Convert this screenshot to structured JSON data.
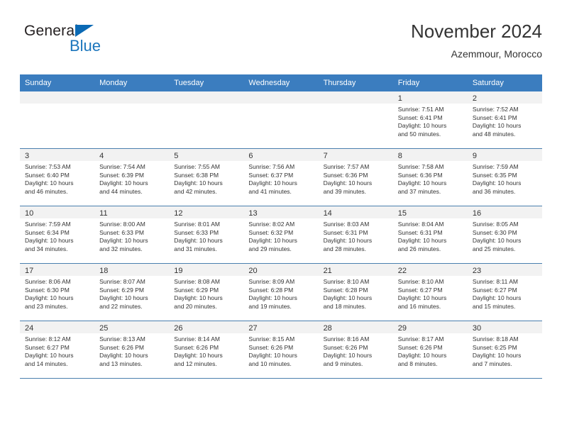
{
  "brand": {
    "name_top": "General",
    "name_bottom": "Blue",
    "triangle_color": "#0a69b4",
    "blue_text_color": "#1b75bc"
  },
  "header": {
    "title": "November 2024",
    "subtitle": "Azemmour, Morocco"
  },
  "colors": {
    "header_row_bg": "#3b7dbf",
    "header_row_text": "#ffffff",
    "daynum_strip_bg": "#f2f2f2",
    "row_divider": "#4a7fae",
    "body_text": "#333333"
  },
  "weekdays": [
    "Sunday",
    "Monday",
    "Tuesday",
    "Wednesday",
    "Thursday",
    "Friday",
    "Saturday"
  ],
  "weeks": [
    [
      {
        "day": "",
        "lines": []
      },
      {
        "day": "",
        "lines": []
      },
      {
        "day": "",
        "lines": []
      },
      {
        "day": "",
        "lines": []
      },
      {
        "day": "",
        "lines": []
      },
      {
        "day": "1",
        "lines": [
          "Sunrise: 7:51 AM",
          "Sunset: 6:41 PM",
          "Daylight: 10 hours",
          "and 50 minutes."
        ]
      },
      {
        "day": "2",
        "lines": [
          "Sunrise: 7:52 AM",
          "Sunset: 6:41 PM",
          "Daylight: 10 hours",
          "and 48 minutes."
        ]
      }
    ],
    [
      {
        "day": "3",
        "lines": [
          "Sunrise: 7:53 AM",
          "Sunset: 6:40 PM",
          "Daylight: 10 hours",
          "and 46 minutes."
        ]
      },
      {
        "day": "4",
        "lines": [
          "Sunrise: 7:54 AM",
          "Sunset: 6:39 PM",
          "Daylight: 10 hours",
          "and 44 minutes."
        ]
      },
      {
        "day": "5",
        "lines": [
          "Sunrise: 7:55 AM",
          "Sunset: 6:38 PM",
          "Daylight: 10 hours",
          "and 42 minutes."
        ]
      },
      {
        "day": "6",
        "lines": [
          "Sunrise: 7:56 AM",
          "Sunset: 6:37 PM",
          "Daylight: 10 hours",
          "and 41 minutes."
        ]
      },
      {
        "day": "7",
        "lines": [
          "Sunrise: 7:57 AM",
          "Sunset: 6:36 PM",
          "Daylight: 10 hours",
          "and 39 minutes."
        ]
      },
      {
        "day": "8",
        "lines": [
          "Sunrise: 7:58 AM",
          "Sunset: 6:36 PM",
          "Daylight: 10 hours",
          "and 37 minutes."
        ]
      },
      {
        "day": "9",
        "lines": [
          "Sunrise: 7:59 AM",
          "Sunset: 6:35 PM",
          "Daylight: 10 hours",
          "and 36 minutes."
        ]
      }
    ],
    [
      {
        "day": "10",
        "lines": [
          "Sunrise: 7:59 AM",
          "Sunset: 6:34 PM",
          "Daylight: 10 hours",
          "and 34 minutes."
        ]
      },
      {
        "day": "11",
        "lines": [
          "Sunrise: 8:00 AM",
          "Sunset: 6:33 PM",
          "Daylight: 10 hours",
          "and 32 minutes."
        ]
      },
      {
        "day": "12",
        "lines": [
          "Sunrise: 8:01 AM",
          "Sunset: 6:33 PM",
          "Daylight: 10 hours",
          "and 31 minutes."
        ]
      },
      {
        "day": "13",
        "lines": [
          "Sunrise: 8:02 AM",
          "Sunset: 6:32 PM",
          "Daylight: 10 hours",
          "and 29 minutes."
        ]
      },
      {
        "day": "14",
        "lines": [
          "Sunrise: 8:03 AM",
          "Sunset: 6:31 PM",
          "Daylight: 10 hours",
          "and 28 minutes."
        ]
      },
      {
        "day": "15",
        "lines": [
          "Sunrise: 8:04 AM",
          "Sunset: 6:31 PM",
          "Daylight: 10 hours",
          "and 26 minutes."
        ]
      },
      {
        "day": "16",
        "lines": [
          "Sunrise: 8:05 AM",
          "Sunset: 6:30 PM",
          "Daylight: 10 hours",
          "and 25 minutes."
        ]
      }
    ],
    [
      {
        "day": "17",
        "lines": [
          "Sunrise: 8:06 AM",
          "Sunset: 6:30 PM",
          "Daylight: 10 hours",
          "and 23 minutes."
        ]
      },
      {
        "day": "18",
        "lines": [
          "Sunrise: 8:07 AM",
          "Sunset: 6:29 PM",
          "Daylight: 10 hours",
          "and 22 minutes."
        ]
      },
      {
        "day": "19",
        "lines": [
          "Sunrise: 8:08 AM",
          "Sunset: 6:29 PM",
          "Daylight: 10 hours",
          "and 20 minutes."
        ]
      },
      {
        "day": "20",
        "lines": [
          "Sunrise: 8:09 AM",
          "Sunset: 6:28 PM",
          "Daylight: 10 hours",
          "and 19 minutes."
        ]
      },
      {
        "day": "21",
        "lines": [
          "Sunrise: 8:10 AM",
          "Sunset: 6:28 PM",
          "Daylight: 10 hours",
          "and 18 minutes."
        ]
      },
      {
        "day": "22",
        "lines": [
          "Sunrise: 8:10 AM",
          "Sunset: 6:27 PM",
          "Daylight: 10 hours",
          "and 16 minutes."
        ]
      },
      {
        "day": "23",
        "lines": [
          "Sunrise: 8:11 AM",
          "Sunset: 6:27 PM",
          "Daylight: 10 hours",
          "and 15 minutes."
        ]
      }
    ],
    [
      {
        "day": "24",
        "lines": [
          "Sunrise: 8:12 AM",
          "Sunset: 6:27 PM",
          "Daylight: 10 hours",
          "and 14 minutes."
        ]
      },
      {
        "day": "25",
        "lines": [
          "Sunrise: 8:13 AM",
          "Sunset: 6:26 PM",
          "Daylight: 10 hours",
          "and 13 minutes."
        ]
      },
      {
        "day": "26",
        "lines": [
          "Sunrise: 8:14 AM",
          "Sunset: 6:26 PM",
          "Daylight: 10 hours",
          "and 12 minutes."
        ]
      },
      {
        "day": "27",
        "lines": [
          "Sunrise: 8:15 AM",
          "Sunset: 6:26 PM",
          "Daylight: 10 hours",
          "and 10 minutes."
        ]
      },
      {
        "day": "28",
        "lines": [
          "Sunrise: 8:16 AM",
          "Sunset: 6:26 PM",
          "Daylight: 10 hours",
          "and 9 minutes."
        ]
      },
      {
        "day": "29",
        "lines": [
          "Sunrise: 8:17 AM",
          "Sunset: 6:26 PM",
          "Daylight: 10 hours",
          "and 8 minutes."
        ]
      },
      {
        "day": "30",
        "lines": [
          "Sunrise: 8:18 AM",
          "Sunset: 6:25 PM",
          "Daylight: 10 hours",
          "and 7 minutes."
        ]
      }
    ]
  ]
}
